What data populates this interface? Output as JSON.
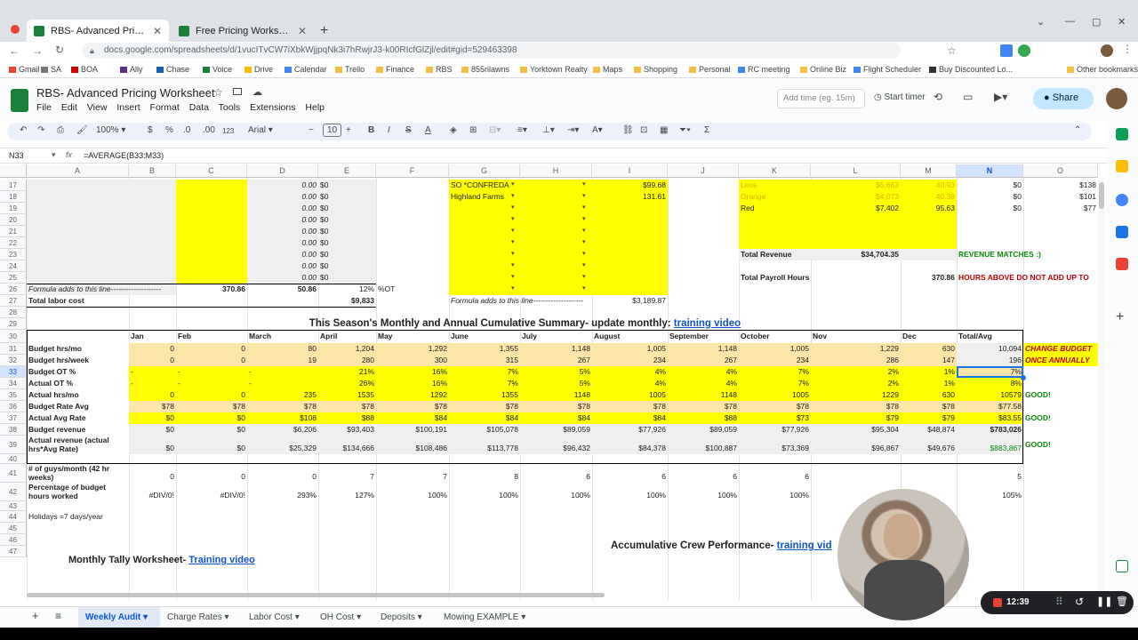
{
  "browser": {
    "tabs": [
      {
        "title": "RBS- Advanced Pricing Work",
        "active": true
      },
      {
        "title": "Free Pricing Worksheet- www.Re",
        "active": false
      }
    ],
    "url": "docs.google.com/spreadsheets/d/1vucITvCW7iXbkWjjpqNk3i7hRwjrJ3-k00RIcfGlZjl/edit#gid=529463398",
    "bookmarks": [
      "Gmail",
      "SA",
      "BOA",
      "Ally",
      "Chase",
      "Voice",
      "Drive",
      "Calendar",
      "Trello",
      "Finance",
      "RBS",
      "855rilawns",
      "Yorktown Realty",
      "Maps",
      "Shopping",
      "Personal",
      "RC meeting",
      "Online Biz",
      "Flight Scheduler",
      "Buy Discounted Lo...",
      "Other bookmarks"
    ]
  },
  "docs": {
    "title": "RBS- Advanced Pricing Worksheet",
    "menu": [
      "File",
      "Edit",
      "View",
      "Insert",
      "Format",
      "Data",
      "Tools",
      "Extensions",
      "Help"
    ],
    "add_time_placeholder": "Add time (eg. 15m)",
    "start_timer": "Start timer",
    "share": "Share"
  },
  "toolbar": {
    "zoom": "100%",
    "currency": "$",
    "percent": "%",
    "dec_minus": ".0",
    "dec_plus": ".00",
    "format_123": "123",
    "font": "Arial",
    "font_size": "10",
    "bold": "B",
    "italic": "I",
    "minus": "−",
    "plus": "+",
    "sigma": "Σ"
  },
  "formula_bar": {
    "cell_ref": "N33",
    "formula": "=AVERAGE(B33:M33)"
  },
  "columns": [
    "A",
    "B",
    "C",
    "D",
    "E",
    "F",
    "G",
    "H",
    "I",
    "J",
    "K",
    "L",
    "M",
    "N",
    "O"
  ],
  "rows": [
    "17",
    "18",
    "19",
    "20",
    "21",
    "22",
    "23",
    "24",
    "25",
    "26",
    "27",
    "28",
    "29",
    "30",
    "31",
    "32",
    "33",
    "34",
    "35",
    "36",
    "37",
    "38",
    "39",
    "40",
    "41",
    "42",
    "43",
    "44",
    "45",
    "46",
    "47"
  ],
  "upper": {
    "d_values": [
      "0.00",
      "0.00",
      "0.00",
      "0.00",
      "0.00",
      "0.00",
      "0.00",
      "0.00",
      "0.00"
    ],
    "e_values": [
      "$0",
      "$0",
      "$0",
      "$0",
      "$0",
      "$0",
      "$0",
      "$0",
      "$0"
    ],
    "row26": {
      "a": "Formula adds to this line--------------------",
      "c": "370.86",
      "d": "50.86",
      "e": "12%",
      "f": "%OT"
    },
    "row27": {
      "a": "Total labor cost",
      "e": "$9,833"
    },
    "g17": "SO *CONFREDA",
    "i17": "$99.68",
    "g18": "Highland Farms",
    "i18": "131.61",
    "g27": "Formula adds to this line--------------------",
    "i27": "$3,189.87",
    "k17": "Leos",
    "l17": "$5,663",
    "m17": "40.93",
    "k18": "Orange",
    "l18": "$4,073",
    "m18": "40.38",
    "k19": "Red",
    "l19": "$7,402",
    "m19": "95.63",
    "n17": "$0",
    "n18": "$0",
    "n19": "$0",
    "o17": "$138",
    "o18": "$101",
    "o19": "$77",
    "k23": "Total Revenue",
    "l23": "$34,704.35",
    "n23": "REVENUE MATCHES :)",
    "k25": "Total Payroll Hours",
    "m25": "370.86",
    "n25": "HOURS ABOVE DO NOT ADD UP TO"
  },
  "summary": {
    "title": "This Season's Monthly and Annual Cumulative Summary- update monthly:",
    "title_link": "training video",
    "months": [
      "Jan",
      "Feb",
      "March",
      "April",
      "May",
      "June",
      "July",
      "August",
      "September",
      "October",
      "Nov",
      "Dec",
      "Total/Avg"
    ],
    "change_note_1": "CHANGE BUDGET",
    "change_note_2": "ONCE ANNUALLY",
    "rows": [
      {
        "label": "Budget hrs/mo",
        "values": [
          "0",
          "0",
          "80",
          "1,204",
          "1,292",
          "1,355",
          "1,148",
          "1,005",
          "1,148",
          "1,005",
          "1,229",
          "630",
          "10,094"
        ],
        "note": ""
      },
      {
        "label": "Budget hrs/week",
        "values": [
          "0",
          "0",
          "19",
          "280",
          "300",
          "315",
          "267",
          "234",
          "267",
          "234",
          "286",
          "147",
          "196"
        ],
        "note": ""
      },
      {
        "label": "Budget OT %",
        "values": [
          "-",
          "-",
          "-",
          "21%",
          "16%",
          "7%",
          "5%",
          "4%",
          "4%",
          "7%",
          "2%",
          "1%",
          "7%"
        ],
        "note": ""
      },
      {
        "label": "Actual OT %",
        "values": [
          "-",
          "-",
          "-",
          "26%",
          "16%",
          "7%",
          "5%",
          "4%",
          "4%",
          "7%",
          "2%",
          "1%",
          "8%"
        ],
        "note": ""
      },
      {
        "label": "Actual hrs/mo",
        "values": [
          "0",
          "0",
          "235",
          "1535",
          "1292",
          "1355",
          "1148",
          "1005",
          "1148",
          "1005",
          "1229",
          "630",
          "10579"
        ],
        "note": "GOOD!"
      },
      {
        "label": "Budget Rate Avg",
        "values": [
          "$78",
          "$78",
          "$78",
          "$78",
          "$78",
          "$78",
          "$78",
          "$78",
          "$78",
          "$78",
          "$78",
          "$78",
          "$77.58"
        ],
        "note": ""
      },
      {
        "label": "Actual Avg Rate",
        "values": [
          "$0",
          "$0",
          "$108",
          "$88",
          "$84",
          "$84",
          "$84",
          "$84",
          "$88",
          "$73",
          "$79",
          "$79",
          "$83.55"
        ],
        "note": "GOOD!"
      },
      {
        "label": "Budget revenue",
        "values": [
          "$0",
          "$0",
          "$6,206",
          "$93,403",
          "$100,191",
          "$105,078",
          "$89,059",
          "$77,926",
          "$89,059",
          "$77,926",
          "$95,304",
          "$48,874",
          "$783,026"
        ],
        "note": ""
      },
      {
        "label": "Actual revenue (actual hrs*Avg Rate)",
        "values": [
          "$0",
          "$0",
          "$25,329",
          "$134,666",
          "$108,486",
          "$113,778",
          "$96,432",
          "$84,378",
          "$100,887",
          "$73,369",
          "$96,867",
          "$49,676",
          "$883,867"
        ],
        "note": "GOOD!"
      },
      {
        "label": "# of guys/month (42 hr weeks)",
        "values": [
          "0",
          "0",
          "0",
          "7",
          "7",
          "8",
          "6",
          "6",
          "6",
          "6",
          "",
          "",
          "5"
        ],
        "note": ""
      },
      {
        "label": "Percentage of budget hours worked",
        "values": [
          "#DIV/0!",
          "#DIV/0!",
          "293%",
          "127%",
          "100%",
          "100%",
          "100%",
          "100%",
          "100%",
          "100%",
          "",
          "",
          "105%"
        ],
        "note": ""
      }
    ],
    "holidays": "Holidays =7 days/year"
  },
  "bottom": {
    "accum_title": "Accumulative Crew Performance-",
    "accum_link": "training vid",
    "monthly_tally": "Monthly Tally Worksheet-",
    "monthly_link": "Training video"
  },
  "sheet_tabs": [
    "Weekly Audit",
    "Charge Rates",
    "Labor Cost",
    "OH Cost",
    "Deposits",
    "Mowing EXAMPLE"
  ],
  "recorder": {
    "time": "12:39"
  }
}
